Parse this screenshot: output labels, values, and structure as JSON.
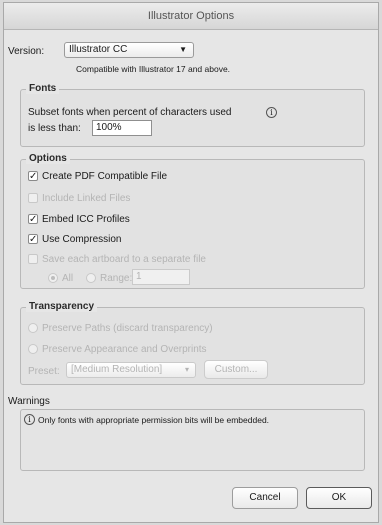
{
  "window": {
    "title": "Illustrator Options"
  },
  "version": {
    "label": "Version:",
    "selected": "Illustrator CC",
    "note": "Compatible with Illustrator 17 and above."
  },
  "fonts": {
    "legend": "Fonts",
    "subset_text_1": "Subset fonts when percent of characters used",
    "subset_text_2": "is less than:",
    "subset_value": "100%",
    "info_icon": "i"
  },
  "options": {
    "legend": "Options",
    "create_pdf": {
      "label": "Create PDF Compatible File",
      "checked": true,
      "enabled": true
    },
    "include_linked": {
      "label": "Include Linked Files",
      "checked": false,
      "enabled": false
    },
    "embed_icc": {
      "label": "Embed ICC Profiles",
      "checked": true,
      "enabled": true
    },
    "use_compression": {
      "label": "Use Compression",
      "checked": true,
      "enabled": true
    },
    "save_artboards": {
      "label": "Save each artboard to a separate file",
      "checked": false,
      "enabled": false
    },
    "all_label": "All",
    "range_label": "Range:",
    "range_value": "1"
  },
  "transparency": {
    "legend": "Transparency",
    "preserve_paths": "Preserve Paths (discard transparency)",
    "preserve_appearance": "Preserve Appearance and Overprints",
    "preset_label": "Preset:",
    "preset_value": "[Medium Resolution]",
    "custom_button": "Custom..."
  },
  "warnings": {
    "label": "Warnings",
    "info_icon": "i",
    "message": "Only fonts with appropriate permission bits will be embedded."
  },
  "buttons": {
    "cancel": "Cancel",
    "ok": "OK"
  }
}
